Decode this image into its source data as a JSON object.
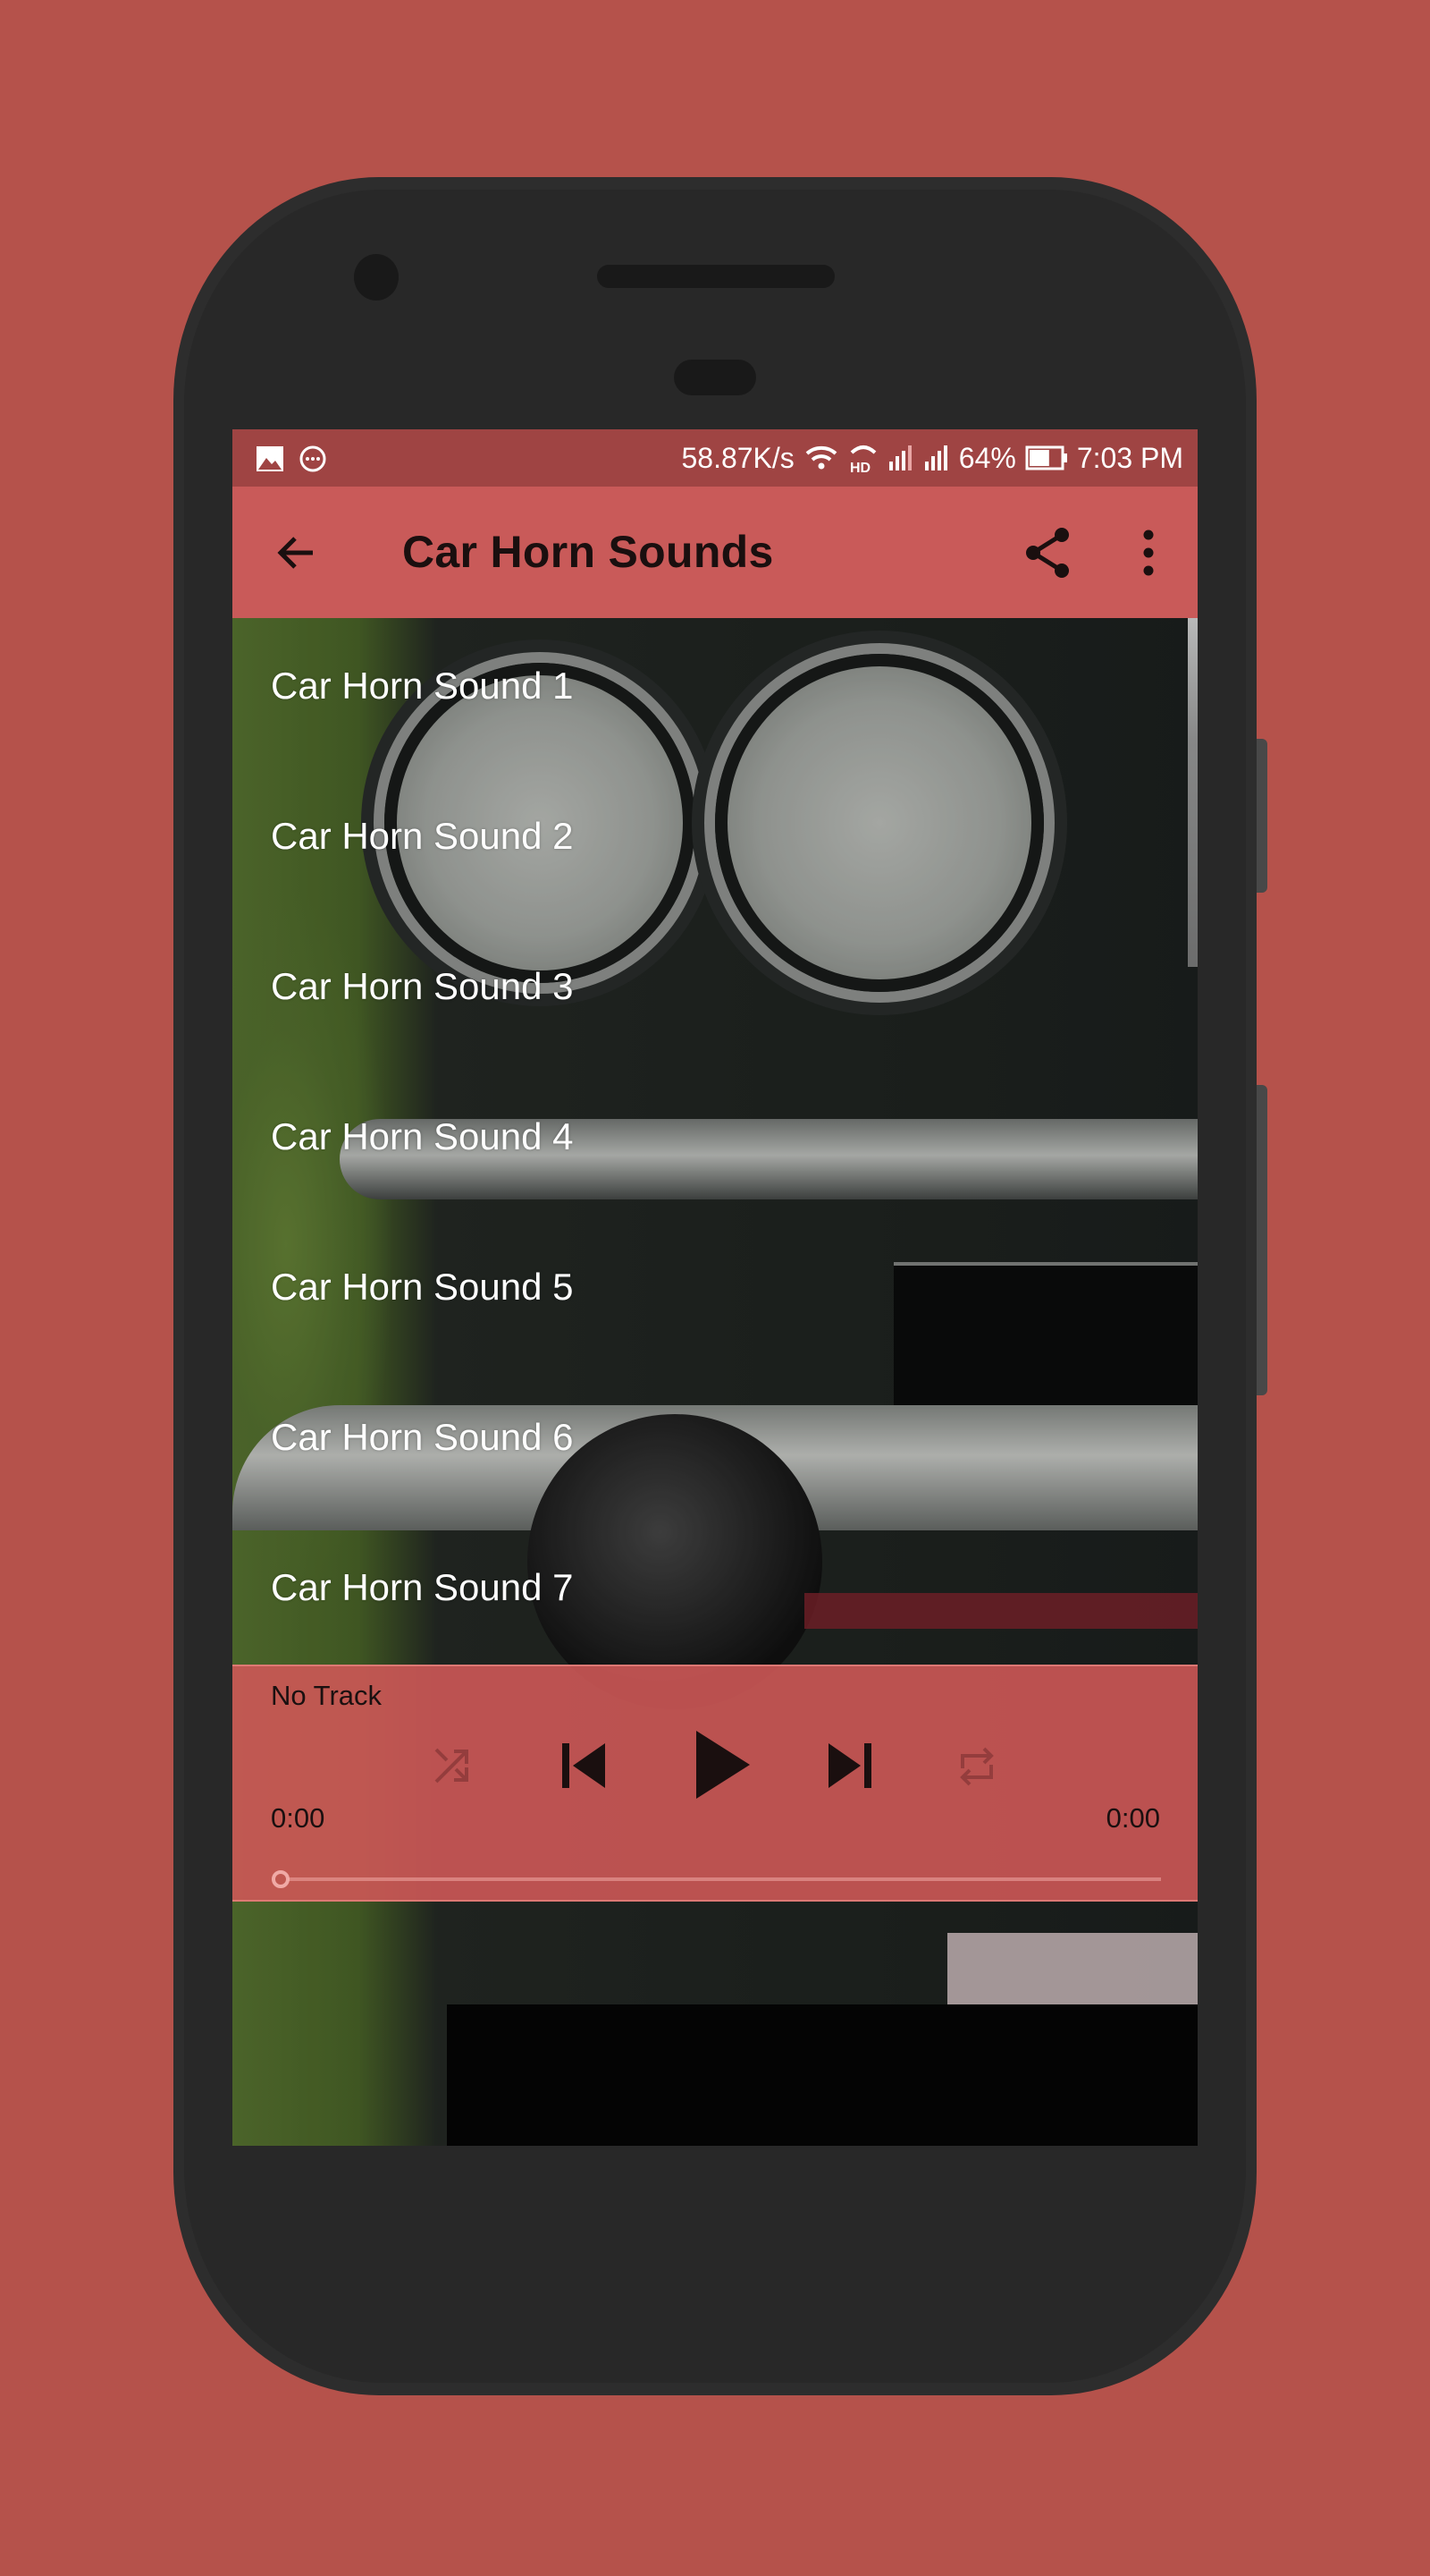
{
  "status_bar": {
    "notification_icons": [
      "image-icon",
      "chat-bubble-icon"
    ],
    "network_speed": "58.87K/s",
    "system_icons": [
      "wifi-icon",
      "hd-call-icon",
      "signal-sim1-icon",
      "signal-sim2-icon"
    ],
    "battery_percent": "64%",
    "battery_level": 0.64,
    "time": "7:03 PM"
  },
  "toolbar": {
    "back_icon": "arrow-back-icon",
    "title": "Car Horn Sounds",
    "share_icon": "share-icon",
    "more_icon": "more-vertical-icon"
  },
  "sounds": [
    {
      "label": "Car Horn Sound 1"
    },
    {
      "label": "Car Horn Sound 2"
    },
    {
      "label": "Car Horn Sound 3"
    },
    {
      "label": "Car Horn Sound 4"
    },
    {
      "label": "Car Horn Sound 5"
    },
    {
      "label": "Car Horn Sound 6"
    },
    {
      "label": "Car Horn Sound 7"
    }
  ],
  "player": {
    "track_title": "No Track",
    "elapsed": "0:00",
    "duration": "0:00",
    "progress": 0,
    "controls": [
      "shuffle-icon",
      "skip-previous-icon",
      "play-icon",
      "skip-next-icon",
      "repeat-icon"
    ]
  },
  "colors": {
    "background": "#b5524b",
    "status_bar": "#9f4443",
    "toolbar": "#c95a59",
    "player": "#cd5856",
    "phone_body": "#2d2d2d"
  }
}
